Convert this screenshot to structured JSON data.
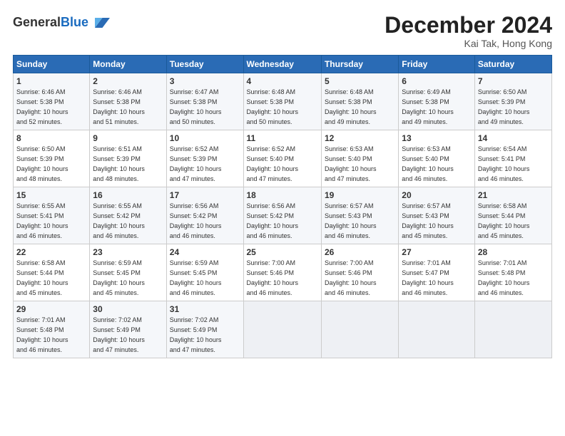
{
  "logo": {
    "line1": "General",
    "line2": "Blue"
  },
  "title": "December 2024",
  "subtitle": "Kai Tak, Hong Kong",
  "headers": [
    "Sunday",
    "Monday",
    "Tuesday",
    "Wednesday",
    "Thursday",
    "Friday",
    "Saturday"
  ],
  "weeks": [
    [
      {
        "day": "1",
        "info": "Sunrise: 6:46 AM\nSunset: 5:38 PM\nDaylight: 10 hours\nand 52 minutes."
      },
      {
        "day": "2",
        "info": "Sunrise: 6:46 AM\nSunset: 5:38 PM\nDaylight: 10 hours\nand 51 minutes."
      },
      {
        "day": "3",
        "info": "Sunrise: 6:47 AM\nSunset: 5:38 PM\nDaylight: 10 hours\nand 50 minutes."
      },
      {
        "day": "4",
        "info": "Sunrise: 6:48 AM\nSunset: 5:38 PM\nDaylight: 10 hours\nand 50 minutes."
      },
      {
        "day": "5",
        "info": "Sunrise: 6:48 AM\nSunset: 5:38 PM\nDaylight: 10 hours\nand 49 minutes."
      },
      {
        "day": "6",
        "info": "Sunrise: 6:49 AM\nSunset: 5:38 PM\nDaylight: 10 hours\nand 49 minutes."
      },
      {
        "day": "7",
        "info": "Sunrise: 6:50 AM\nSunset: 5:39 PM\nDaylight: 10 hours\nand 49 minutes."
      }
    ],
    [
      {
        "day": "8",
        "info": "Sunrise: 6:50 AM\nSunset: 5:39 PM\nDaylight: 10 hours\nand 48 minutes."
      },
      {
        "day": "9",
        "info": "Sunrise: 6:51 AM\nSunset: 5:39 PM\nDaylight: 10 hours\nand 48 minutes."
      },
      {
        "day": "10",
        "info": "Sunrise: 6:52 AM\nSunset: 5:39 PM\nDaylight: 10 hours\nand 47 minutes."
      },
      {
        "day": "11",
        "info": "Sunrise: 6:52 AM\nSunset: 5:40 PM\nDaylight: 10 hours\nand 47 minutes."
      },
      {
        "day": "12",
        "info": "Sunrise: 6:53 AM\nSunset: 5:40 PM\nDaylight: 10 hours\nand 47 minutes."
      },
      {
        "day": "13",
        "info": "Sunrise: 6:53 AM\nSunset: 5:40 PM\nDaylight: 10 hours\nand 46 minutes."
      },
      {
        "day": "14",
        "info": "Sunrise: 6:54 AM\nSunset: 5:41 PM\nDaylight: 10 hours\nand 46 minutes."
      }
    ],
    [
      {
        "day": "15",
        "info": "Sunrise: 6:55 AM\nSunset: 5:41 PM\nDaylight: 10 hours\nand 46 minutes."
      },
      {
        "day": "16",
        "info": "Sunrise: 6:55 AM\nSunset: 5:42 PM\nDaylight: 10 hours\nand 46 minutes."
      },
      {
        "day": "17",
        "info": "Sunrise: 6:56 AM\nSunset: 5:42 PM\nDaylight: 10 hours\nand 46 minutes."
      },
      {
        "day": "18",
        "info": "Sunrise: 6:56 AM\nSunset: 5:42 PM\nDaylight: 10 hours\nand 46 minutes."
      },
      {
        "day": "19",
        "info": "Sunrise: 6:57 AM\nSunset: 5:43 PM\nDaylight: 10 hours\nand 46 minutes."
      },
      {
        "day": "20",
        "info": "Sunrise: 6:57 AM\nSunset: 5:43 PM\nDaylight: 10 hours\nand 45 minutes."
      },
      {
        "day": "21",
        "info": "Sunrise: 6:58 AM\nSunset: 5:44 PM\nDaylight: 10 hours\nand 45 minutes."
      }
    ],
    [
      {
        "day": "22",
        "info": "Sunrise: 6:58 AM\nSunset: 5:44 PM\nDaylight: 10 hours\nand 45 minutes."
      },
      {
        "day": "23",
        "info": "Sunrise: 6:59 AM\nSunset: 5:45 PM\nDaylight: 10 hours\nand 45 minutes."
      },
      {
        "day": "24",
        "info": "Sunrise: 6:59 AM\nSunset: 5:45 PM\nDaylight: 10 hours\nand 46 minutes."
      },
      {
        "day": "25",
        "info": "Sunrise: 7:00 AM\nSunset: 5:46 PM\nDaylight: 10 hours\nand 46 minutes."
      },
      {
        "day": "26",
        "info": "Sunrise: 7:00 AM\nSunset: 5:46 PM\nDaylight: 10 hours\nand 46 minutes."
      },
      {
        "day": "27",
        "info": "Sunrise: 7:01 AM\nSunset: 5:47 PM\nDaylight: 10 hours\nand 46 minutes."
      },
      {
        "day": "28",
        "info": "Sunrise: 7:01 AM\nSunset: 5:48 PM\nDaylight: 10 hours\nand 46 minutes."
      }
    ],
    [
      {
        "day": "29",
        "info": "Sunrise: 7:01 AM\nSunset: 5:48 PM\nDaylight: 10 hours\nand 46 minutes."
      },
      {
        "day": "30",
        "info": "Sunrise: 7:02 AM\nSunset: 5:49 PM\nDaylight: 10 hours\nand 47 minutes."
      },
      {
        "day": "31",
        "info": "Sunrise: 7:02 AM\nSunset: 5:49 PM\nDaylight: 10 hours\nand 47 minutes."
      },
      null,
      null,
      null,
      null
    ]
  ]
}
